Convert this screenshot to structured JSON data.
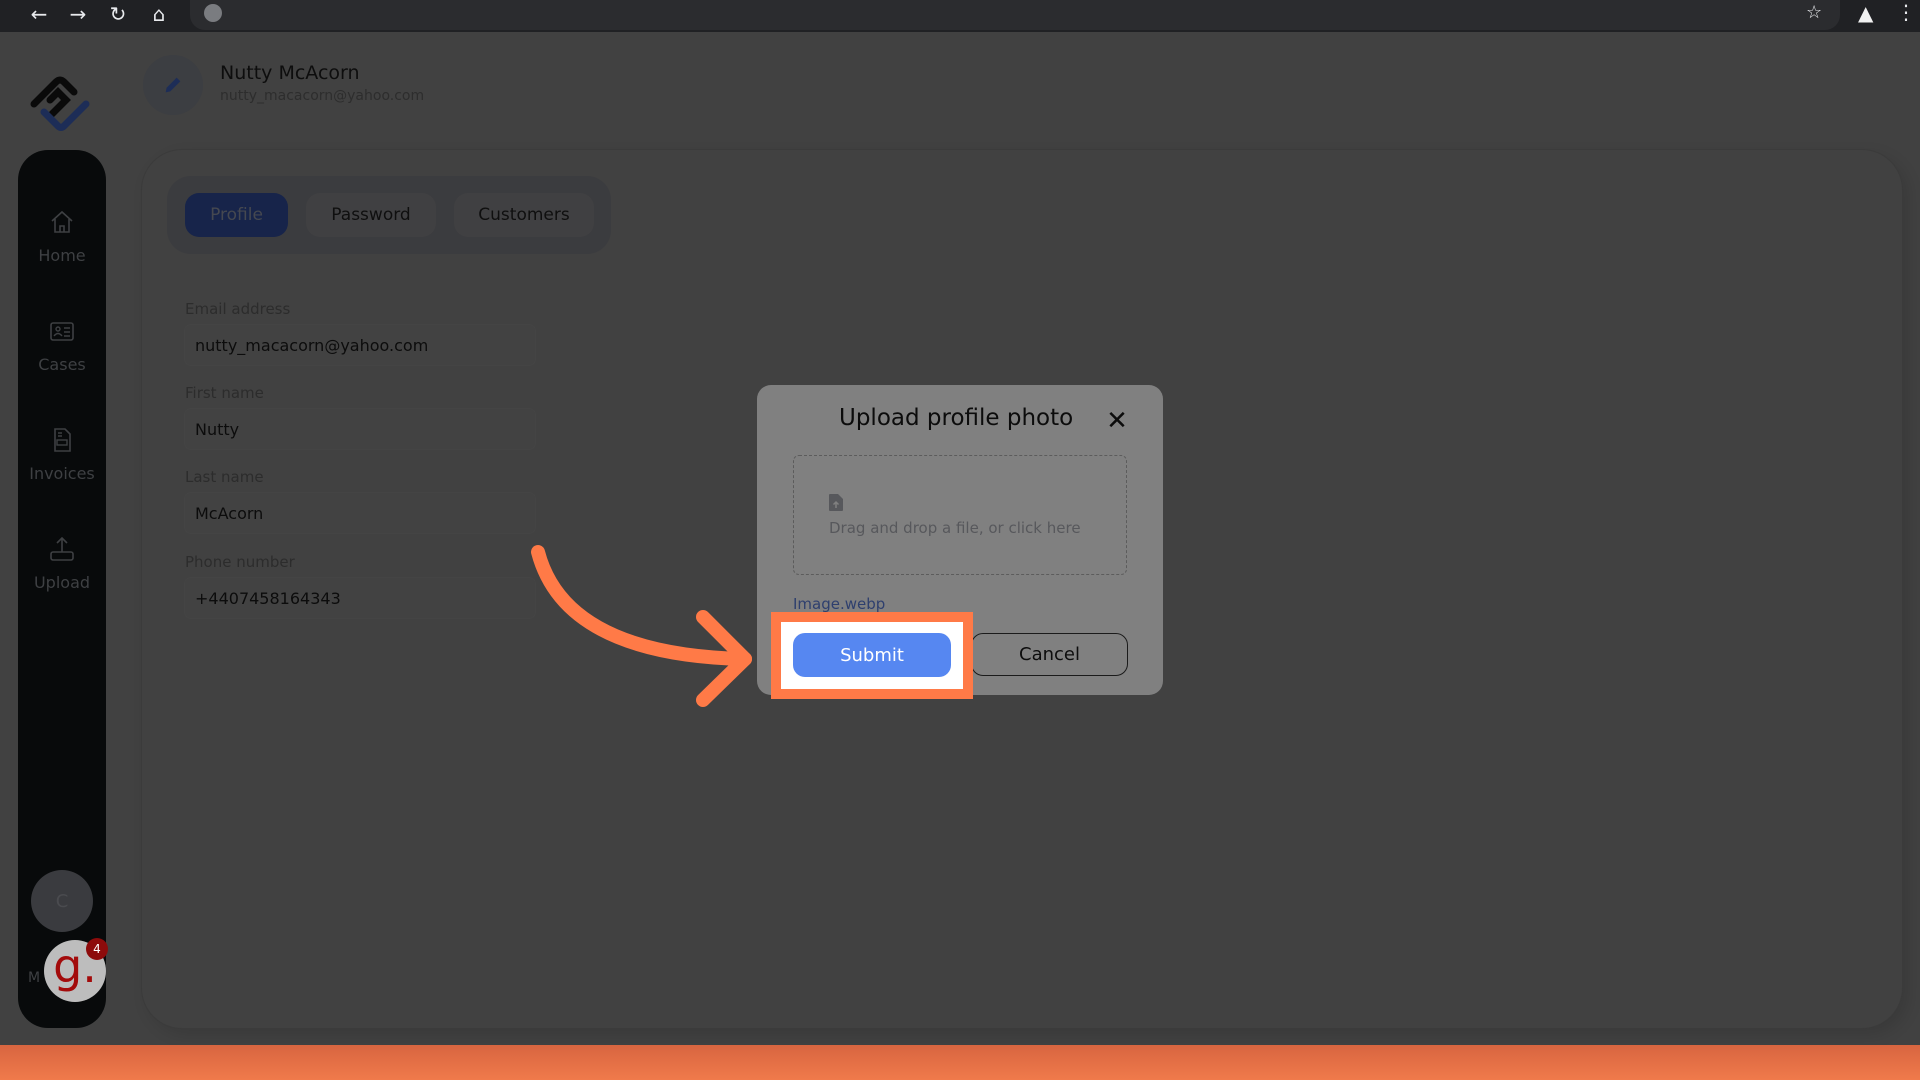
{
  "browser": {
    "back_icon": "arrow-left",
    "forward_icon": "arrow-right",
    "reload_icon": "reload",
    "home_icon": "home",
    "site_icon": "globe",
    "bookmark_icon": "star",
    "extensions_icon": "puzzle",
    "menu_icon": "kebab"
  },
  "header": {
    "user_name": "Nutty McAcorn",
    "user_email": "nutty_macacorn@yahoo.com",
    "edit_icon": "pencil"
  },
  "sidebar": {
    "items": [
      {
        "label": "Home",
        "icon": "home"
      },
      {
        "label": "Cases",
        "icon": "id-card"
      },
      {
        "label": "Invoices",
        "icon": "document"
      },
      {
        "label": "Upload",
        "icon": "upload"
      }
    ],
    "avatar_initial": "C",
    "more_label": "M"
  },
  "tabs": [
    {
      "label": "Profile",
      "active": true
    },
    {
      "label": "Password",
      "active": false
    },
    {
      "label": "Customers",
      "active": false
    }
  ],
  "form": {
    "fields": [
      {
        "label": "Email address",
        "value": "nutty_macacorn@yahoo.com"
      },
      {
        "label": "First name",
        "value": "Nutty"
      },
      {
        "label": "Last name",
        "value": "McAcorn"
      },
      {
        "label": "Phone number",
        "value": "+4407458164343"
      }
    ]
  },
  "modal": {
    "title": "Upload profile photo",
    "close_icon": "x",
    "dropzone_text": "Drag and drop a file, or click here",
    "dropzone_icon": "file-upload",
    "selected_file": "Image.webp",
    "submit_label": "Submit",
    "cancel_label": "Cancel"
  },
  "annotation": {
    "highlight_color": "#ff7a47",
    "target": "Submit"
  },
  "chat_widget": {
    "glyph": "g.",
    "badge_count": "4"
  },
  "colors": {
    "accent_blue": "#5687f1",
    "annotation_orange": "#ff7a47",
    "active_tab": "#17244a"
  }
}
